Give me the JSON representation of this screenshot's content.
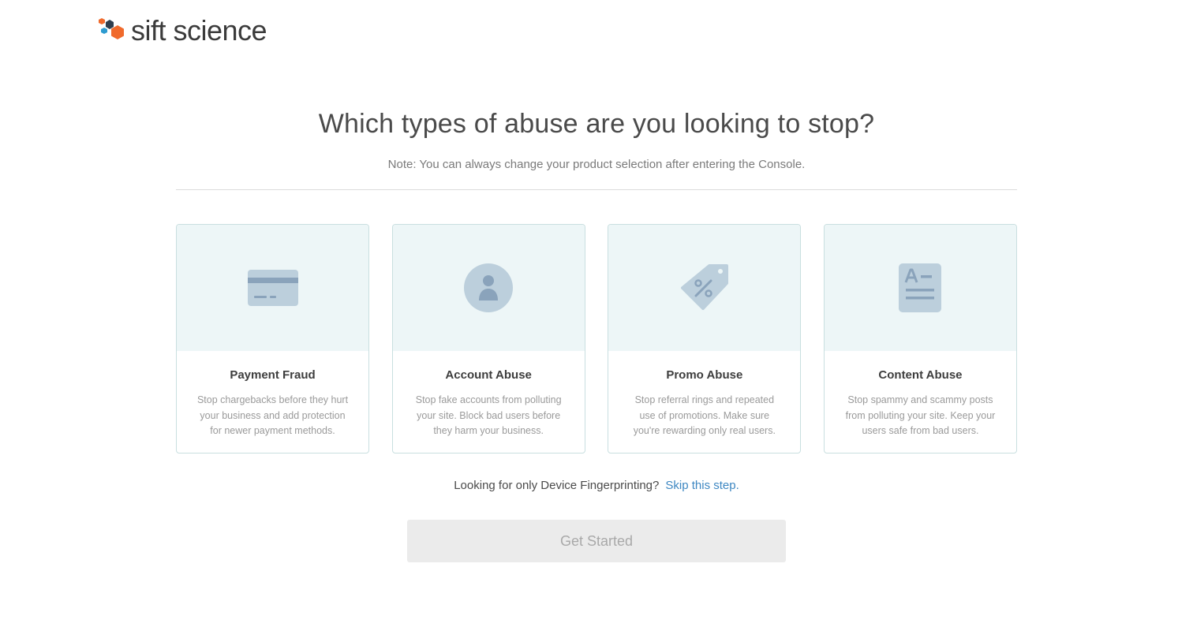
{
  "brand": {
    "name": "sift science",
    "colors": {
      "orange": "#f06a2c",
      "blue": "#2e9bd0",
      "dark": "#2f3e4e",
      "text": "#3b3b3b"
    }
  },
  "header": {
    "title": "Which types of abuse are you looking to stop?",
    "note": "Note: You can always change your product selection after entering the Console."
  },
  "cards": [
    {
      "icon": "credit-card-icon",
      "title": "Payment Fraud",
      "description": "Stop chargebacks before they hurt your business and add protection for newer payment methods."
    },
    {
      "icon": "user-icon",
      "title": "Account Abuse",
      "description": "Stop fake accounts from polluting your site. Block bad users before they harm your business."
    },
    {
      "icon": "promo-tag-icon",
      "title": "Promo Abuse",
      "description": "Stop referral rings and repeated use of promotions. Make sure you're rewarding only real users."
    },
    {
      "icon": "document-icon",
      "title": "Content Abuse",
      "description": "Stop spammy and scammy posts from polluting your site. Keep your users safe from bad users."
    }
  ],
  "skip": {
    "question": "Looking for only Device Fingerprinting?",
    "link_label": "Skip this step."
  },
  "cta": {
    "label": "Get Started",
    "state": "disabled"
  },
  "theme": {
    "card_top_bg": "#edf6f7",
    "card_border": "#c9dfe0",
    "icon_fill": "#bccfdc",
    "icon_detail": "#8aa3bb",
    "link": "#3d87c2",
    "button_bg": "#ebebeb",
    "button_text": "#a9a9a9"
  }
}
